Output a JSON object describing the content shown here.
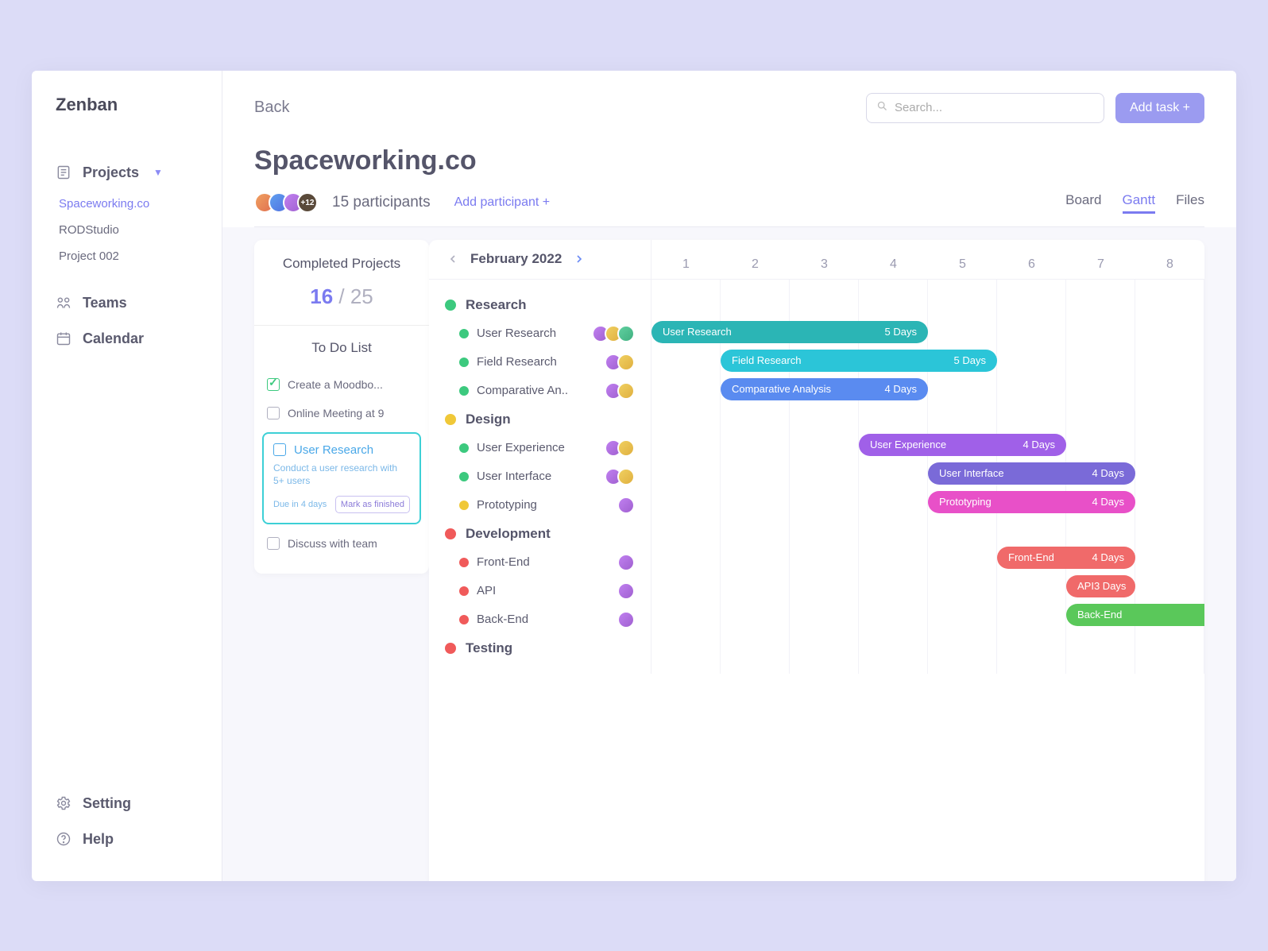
{
  "app_name": "Zenban",
  "sidebar": {
    "nav": {
      "projects_label": "Projects",
      "teams_label": "Teams",
      "calendar_label": "Calendar"
    },
    "projects": [
      {
        "label": "Spaceworking.co",
        "active": true
      },
      {
        "label": "RODStudio",
        "active": false
      },
      {
        "label": "Project 002",
        "active": false
      }
    ],
    "bottom": {
      "setting_label": "Setting",
      "help_label": "Help"
    }
  },
  "header": {
    "back_label": "Back",
    "search_placeholder": "Search...",
    "add_task_label": "Add task +"
  },
  "project": {
    "title": "Spaceworking.co",
    "participants_overflow": "+12",
    "participants_count": "15 participants",
    "add_participant_label": "Add participant +",
    "view_tabs": {
      "board": "Board",
      "gantt": "Gantt",
      "files": "Files"
    }
  },
  "completed": {
    "title": "Completed Projects",
    "done": "16",
    "sep": " / ",
    "total": "25",
    "todo_title": "To Do List",
    "items": [
      {
        "label": "Create a Moodbo...",
        "done": true
      },
      {
        "label": "Online Meeting at 9",
        "done": false
      }
    ],
    "card": {
      "title": "User Research",
      "desc": "Conduct a user research with 5+ users",
      "due": "Due in 4 days",
      "mark": "Mark as finished"
    },
    "after": [
      {
        "label": "Discuss with team",
        "done": false
      }
    ]
  },
  "gantt": {
    "month": "February 2022",
    "days": [
      "1",
      "2",
      "3",
      "4",
      "5",
      "6",
      "7",
      "8"
    ],
    "groups": [
      {
        "name": "Research",
        "colorClass": "bg-green",
        "tasks": [
          {
            "name": "User Research",
            "dotClass": "bg-green",
            "avatars": 3,
            "bar": {
              "colorClass": "c-teal",
              "start": 0,
              "span": 4,
              "duration": "5 Days"
            }
          },
          {
            "name": "Field Research",
            "dotClass": "bg-green",
            "avatars": 2,
            "bar": {
              "colorClass": "c-cyan",
              "start": 1,
              "span": 4,
              "duration": "5 Days"
            }
          },
          {
            "name": "Comparative An..",
            "full": "Comparative Analysis",
            "dotClass": "bg-green",
            "avatars": 2,
            "bar": {
              "colorClass": "c-blue",
              "start": 1,
              "span": 3,
              "duration": "4 Days"
            }
          }
        ]
      },
      {
        "name": "Design",
        "colorClass": "bg-yellow",
        "tasks": [
          {
            "name": "User Experience",
            "dotClass": "bg-green",
            "avatars": 2,
            "bar": {
              "colorClass": "c-purple",
              "start": 3,
              "span": 3,
              "duration": "4 Days"
            }
          },
          {
            "name": "User Interface",
            "dotClass": "bg-green",
            "avatars": 2,
            "bar": {
              "colorClass": "c-violet",
              "start": 4,
              "span": 3,
              "duration": "4 Days"
            }
          },
          {
            "name": "Prototyping",
            "dotClass": "bg-yellow",
            "avatars": 1,
            "bar": {
              "colorClass": "c-pink",
              "start": 4,
              "span": 3,
              "duration": "4 Days"
            }
          }
        ]
      },
      {
        "name": "Development",
        "colorClass": "bg-red",
        "tasks": [
          {
            "name": "Front-End",
            "dotClass": "bg-red",
            "avatars": 1,
            "bar": {
              "colorClass": "c-coral",
              "start": 5,
              "span": 2,
              "duration": "4 Days"
            }
          },
          {
            "name": "API",
            "dotClass": "bg-red",
            "avatars": 1,
            "bar": {
              "colorClass": "c-coral",
              "start": 6,
              "span": 1,
              "duration": "3 Days"
            }
          },
          {
            "name": "Back-End",
            "dotClass": "bg-red",
            "avatars": 1,
            "bar": {
              "colorClass": "c-leaf",
              "start": 6,
              "span": 2,
              "duration": "",
              "noRightRadius": true
            }
          }
        ]
      },
      {
        "name": "Testing",
        "colorClass": "bg-red",
        "tasks": []
      }
    ]
  }
}
